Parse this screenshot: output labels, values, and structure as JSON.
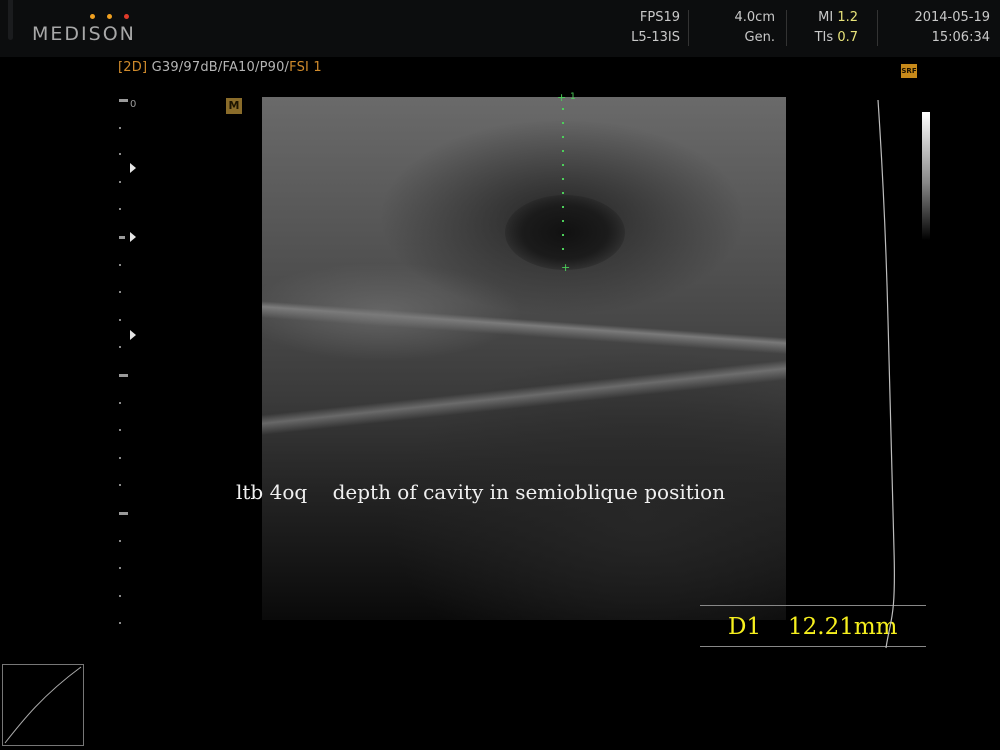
{
  "header": {
    "brand": "MEDISON",
    "brand_dot_colors": [
      "#f0a020",
      "#f0a020",
      "#e03a2a"
    ],
    "fps": "FPS19",
    "probe": "L5-13IS",
    "depth": "4.0cm",
    "preset": "Gen.",
    "mi_label": "MI",
    "mi_value": "1.2",
    "tis_label": "TIs",
    "tis_value": "0.7",
    "date": "2014-05-19",
    "time": "15:06:34"
  },
  "imaging": {
    "mode": "[2D]",
    "params": "G39/97dB/FA10/P90/",
    "fsi": "FSI 1",
    "m_badge": "M",
    "srf_badge": "SRF",
    "depth_zero": "0"
  },
  "annotation": {
    "caption": "ltb 4oq    depth of cavity in semioblique position"
  },
  "measurement": {
    "marker_number": "1",
    "label": "D1",
    "value": "12.21mm",
    "color": "#f7f01e",
    "caliper_color": "#4ccf5a"
  },
  "icons": {
    "focus_markers": [
      "focus-marker-icon",
      "focus-marker-icon",
      "focus-marker-icon"
    ],
    "caliper_start": "caliper-cross-icon",
    "caliper_end": "caliper-cross-icon"
  }
}
